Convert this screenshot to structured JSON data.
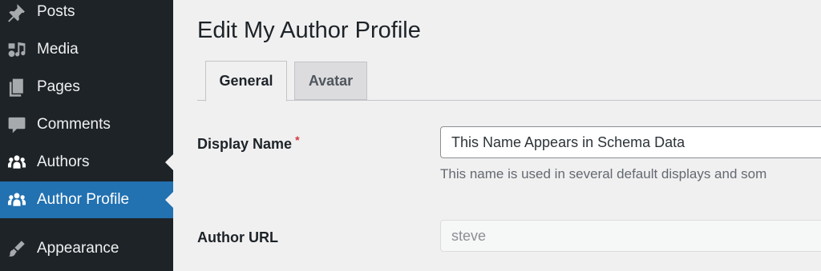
{
  "sidebar": {
    "items": [
      {
        "label": "Posts",
        "icon": "pin-icon",
        "current": false
      },
      {
        "label": "Media",
        "icon": "media-icon",
        "current": false
      },
      {
        "label": "Pages",
        "icon": "pages-icon",
        "current": false
      },
      {
        "label": "Comments",
        "icon": "comments-icon",
        "current": false
      },
      {
        "label": "Authors",
        "icon": "authors-icon",
        "current": false
      },
      {
        "label": "Author Profile",
        "icon": "authors-icon",
        "current": true
      },
      {
        "label": "Appearance",
        "icon": "brush-icon",
        "current": false
      }
    ]
  },
  "main": {
    "title": "Edit My Author Profile",
    "tabs": [
      {
        "label": "General",
        "active": true
      },
      {
        "label": "Avatar",
        "active": false
      }
    ],
    "fields": {
      "display_name": {
        "label": "Display Name",
        "required_marker": "*",
        "value": "This Name Appears in Schema Data",
        "description": "This name is used in several default displays and som"
      },
      "author_url": {
        "label": "Author URL",
        "value": "steve",
        "disabled": true
      }
    }
  },
  "colors": {
    "sidebar_bg": "#1d2327",
    "accent": "#2271b1",
    "page_bg": "#f0f0f1",
    "required": "#d63638"
  }
}
